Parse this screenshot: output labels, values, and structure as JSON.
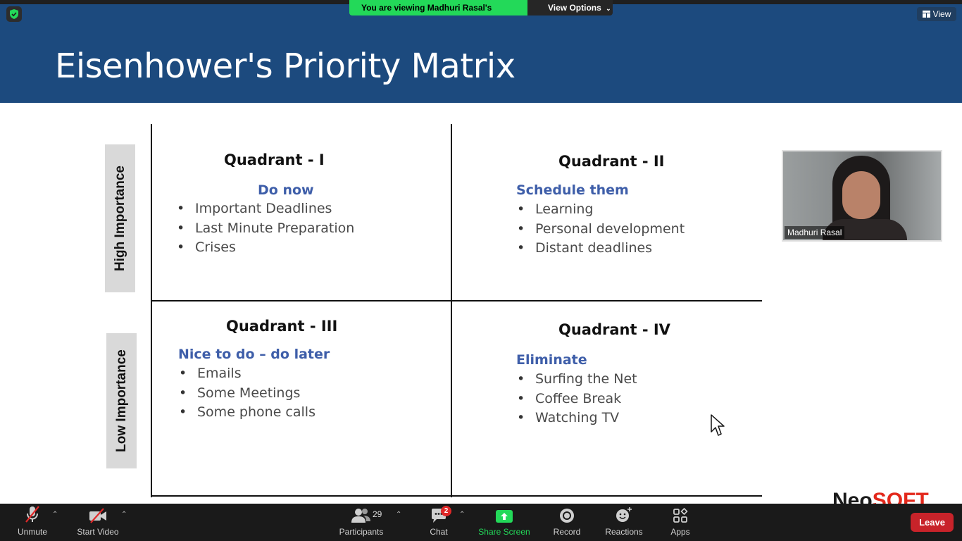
{
  "banner": {
    "viewing_text": "You are viewing Madhuri Rasal's screen",
    "view_options_label": "View Options"
  },
  "view_button": {
    "label": "View"
  },
  "slide": {
    "title": "Eisenhower's Priority Matrix",
    "high_label": "High Importance",
    "low_label": "Low Importance",
    "quadrants": [
      {
        "title": "Quadrant - I",
        "subtitle": "Do now",
        "items": [
          "Important Deadlines",
          "Last Minute Preparation",
          "Crises"
        ]
      },
      {
        "title": "Quadrant - II",
        "subtitle": "Schedule them",
        "items": [
          "Learning",
          "Personal development",
          "Distant deadlines"
        ]
      },
      {
        "title": "Quadrant - III",
        "subtitle": "Nice to do – do later",
        "items": [
          "Emails",
          "Some Meetings",
          "Some phone calls"
        ]
      },
      {
        "title": "Quadrant - IV",
        "subtitle": "Eliminate",
        "items": [
          "Surfing the Net",
          "Coffee Break",
          "Watching TV"
        ]
      }
    ],
    "logo": {
      "neo": "Neo",
      "soft": "SOFT"
    },
    "colors": {
      "header": "#1c4a7e",
      "subtitle": "#3e5ea9",
      "logo_red": "#e3281b"
    }
  },
  "video": {
    "participant_name": "Madhuri Rasal"
  },
  "toolbar": {
    "unmute": "Unmute",
    "start_video": "Start Video",
    "participants": "Participants",
    "participant_count": "29",
    "chat": "Chat",
    "chat_badge": "2",
    "share_screen": "Share Screen",
    "record": "Record",
    "reactions": "Reactions",
    "apps": "Apps",
    "leave": "Leave"
  }
}
